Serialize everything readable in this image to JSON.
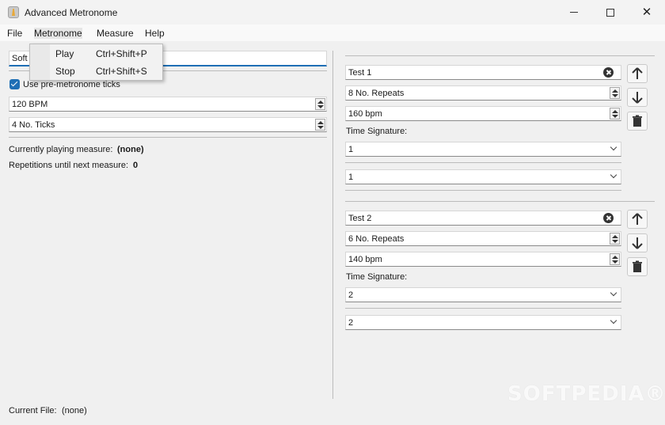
{
  "window": {
    "title": "Advanced Metronome",
    "close_glyph": "✕"
  },
  "menu": {
    "file": "File",
    "metronome": "Metronome",
    "measure": "Measure",
    "help": "Help"
  },
  "dropdown": {
    "items": [
      {
        "label": "Play",
        "shortcut": "Ctrl+Shift+P"
      },
      {
        "label": "Stop",
        "shortcut": "Ctrl+Shift+S"
      }
    ]
  },
  "left": {
    "sound_value": "Soft",
    "pre_ticks_label": "Use pre-metronome ticks",
    "pre_ticks_checked": true,
    "bpm_value": "120 BPM",
    "ticks_value": "4 No. Ticks",
    "current_measure_label": "Currently playing measure:",
    "current_measure_value": "(none)",
    "repetitions_label": "Repetitions until next measure:",
    "repetitions_value": "0"
  },
  "footer": {
    "current_file_label": "Current File:",
    "current_file_value": "(none)"
  },
  "measures": [
    {
      "name": "Test 1",
      "repeats": "8 No. Repeats",
      "bpm": "160 bpm",
      "time_signature_label": "Time Signature:",
      "ts_top": "1",
      "ts_bottom": "1"
    },
    {
      "name": "Test 2",
      "repeats": "6 No. Repeats",
      "bpm": "140 bpm",
      "time_signature_label": "Time Signature:",
      "ts_top": "2",
      "ts_bottom": "2"
    }
  ],
  "icons": [
    "arrow-up-icon",
    "arrow-down-icon",
    "trash-icon",
    "clear-icon",
    "chevron-down-icon"
  ],
  "colors": {
    "accent": "#1f6fb5",
    "background": "#f0f0f0"
  },
  "watermark": "SOFTPEDIA®"
}
